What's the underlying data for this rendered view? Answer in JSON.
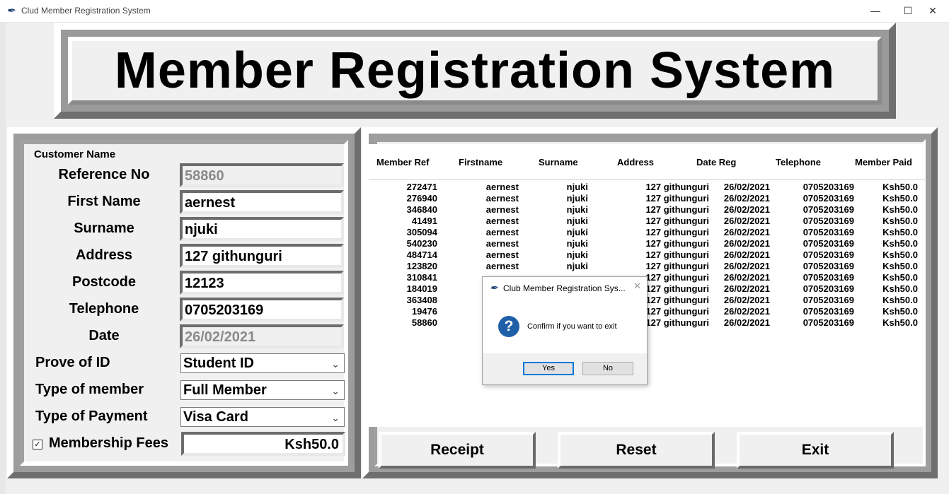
{
  "window": {
    "title": "Clud Member Registration System",
    "minimize": "—",
    "maximize": "☐",
    "close": "✕"
  },
  "header": {
    "title": "Member Registration System"
  },
  "form": {
    "group_label": "Customer Name",
    "reference_label": "Reference No",
    "reference_value": "58860",
    "firstname_label": "First Name",
    "firstname_value": "aernest",
    "surname_label": "Surname",
    "surname_value": "njuki",
    "address_label": "Address",
    "address_value": "127 githunguri",
    "postcode_label": "Postcode",
    "postcode_value": "12123",
    "telephone_label": "Telephone",
    "telephone_value": "0705203169",
    "date_label": "Date",
    "date_value": "26/02/2021",
    "proof_label": "Prove of ID",
    "proof_value": "Student ID",
    "member_type_label": "Type of member",
    "member_type_value": "Full Member",
    "payment_label": "Type of Payment",
    "payment_value": "Visa Card",
    "fees_label": "Membership Fees",
    "fees_checked": "✓",
    "fees_value": "Ksh50.0"
  },
  "table": {
    "columns": [
      "Member Ref",
      "Firstname",
      "Surname",
      "Address",
      "Date Reg",
      "Telephone",
      "Member Paid"
    ],
    "rows": [
      [
        "272471",
        "aernest",
        "njuki",
        "127 githunguri",
        "26/02/2021",
        "0705203169",
        "Ksh50.0"
      ],
      [
        "276940",
        "aernest",
        "njuki",
        "127 githunguri",
        "26/02/2021",
        "0705203169",
        "Ksh50.0"
      ],
      [
        "346840",
        "aernest",
        "njuki",
        "127 githunguri",
        "26/02/2021",
        "0705203169",
        "Ksh50.0"
      ],
      [
        "41491",
        "aernest",
        "njuki",
        "127 githunguri",
        "26/02/2021",
        "0705203169",
        "Ksh50.0"
      ],
      [
        "305094",
        "aernest",
        "njuki",
        "127 githunguri",
        "26/02/2021",
        "0705203169",
        "Ksh50.0"
      ],
      [
        "540230",
        "aernest",
        "njuki",
        "127 githunguri",
        "26/02/2021",
        "0705203169",
        "Ksh50.0"
      ],
      [
        "484714",
        "aernest",
        "njuki",
        "127 githunguri",
        "26/02/2021",
        "0705203169",
        "Ksh50.0"
      ],
      [
        "123820",
        "aernest",
        "njuki",
        "127 githunguri",
        "26/02/2021",
        "0705203169",
        "Ksh50.0"
      ],
      [
        "310841",
        "",
        "",
        "127 githunguri",
        "26/02/2021",
        "0705203169",
        "Ksh50.0"
      ],
      [
        "184019",
        "",
        "",
        "127 githunguri",
        "26/02/2021",
        "0705203169",
        "Ksh50.0"
      ],
      [
        "363408",
        "",
        "",
        "127 githunguri",
        "26/02/2021",
        "0705203169",
        "Ksh50.0"
      ],
      [
        "19476",
        "",
        "",
        "127 githunguri",
        "26/02/2021",
        "0705203169",
        "Ksh50.0"
      ],
      [
        "58860",
        "",
        "",
        "127 githunguri",
        "26/02/2021",
        "0705203169",
        "Ksh50.0"
      ]
    ]
  },
  "buttons": {
    "receipt": "Receipt",
    "reset": "Reset",
    "exit": "Exit"
  },
  "dialog": {
    "title": "Club Member Registration Sys...",
    "message": "Confirm if you want to exit",
    "yes": "Yes",
    "no": "No",
    "icon": "?",
    "close": "✕"
  }
}
